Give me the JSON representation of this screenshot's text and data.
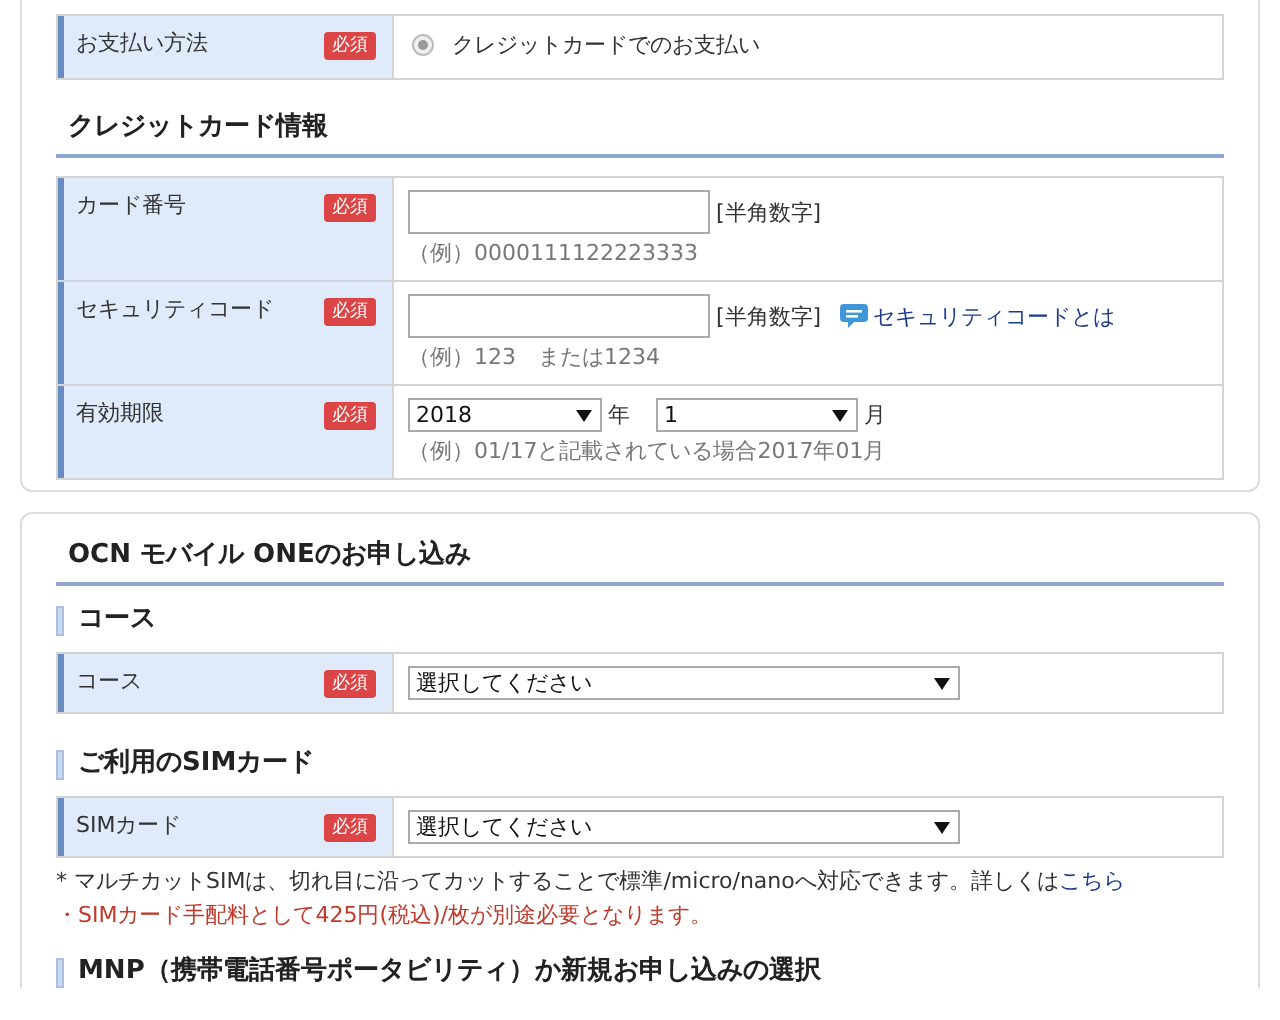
{
  "payment": {
    "label": "お支払い方法",
    "required": "必須",
    "option": {
      "label": "クレジットカードでのお支払い",
      "selected": true
    }
  },
  "credit_card": {
    "title": "クレジットカード情報",
    "rows": [
      {
        "kind": "text",
        "label": "カード番号",
        "required": "必須",
        "hint": "[半角数字]",
        "example": "（例）0000111122223333"
      },
      {
        "kind": "text",
        "label": "セキュリティコード",
        "required": "必須",
        "hint": "[半角数字]",
        "link": "セキュリティコードとは",
        "example": "（例）123　または1234"
      },
      {
        "kind": "expiry",
        "label": "有効期限",
        "required": "必須",
        "year": "2018",
        "year_unit": "年",
        "month": "1",
        "month_unit": "月",
        "example": "（例）01/17と記載されている場合2017年01月"
      }
    ]
  },
  "application": {
    "title": "OCN モバイル ONEのお申し込み",
    "groups": [
      {
        "title": "コース",
        "rows": [
          {
            "kind": "select",
            "label": "コース",
            "required": "必須",
            "value": "選択してください"
          }
        ]
      },
      {
        "title": "ご利用のSIMカード",
        "rows": [
          {
            "kind": "select",
            "label": "SIMカード",
            "required": "必須",
            "value": "選択してください"
          }
        ],
        "notes": [
          {
            "kind": "info",
            "text": "* マルチカットSIMは、切れ目に沿ってカットすることで標準/micro/nanoへ対応できます。詳しくは",
            "link": "こちら"
          },
          {
            "kind": "warning",
            "text": "・SIMカード手配料として425円(税込)/枚が別途必要となります。"
          }
        ]
      },
      {
        "title": "MNP（携帯電話番号ポータビリティ）か新規お申し込みの選択"
      }
    ]
  }
}
